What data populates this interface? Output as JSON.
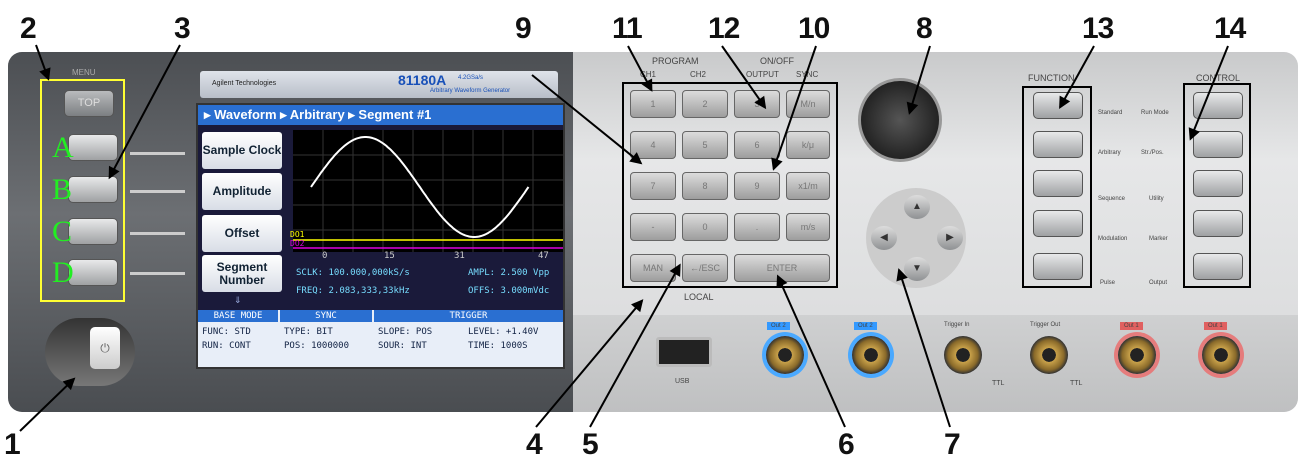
{
  "callouts": [
    "1",
    "2",
    "3",
    "4",
    "5",
    "6",
    "7",
    "8",
    "9",
    "10",
    "11",
    "12",
    "13",
    "14"
  ],
  "menu": {
    "title": "MENU",
    "top_label": "TOP",
    "softkey_letters": [
      "A",
      "B",
      "C",
      "D"
    ]
  },
  "brand": {
    "vendor": "Agilent Technologies",
    "model": "81180A",
    "model_sub": "4.2GSa/s",
    "model_desc": "Arbitrary Waveform Generator"
  },
  "screen": {
    "breadcrumb": "▸ Waveform ▸ Arbitrary ▸ Segment #1",
    "softkeys": [
      "Sample Clock",
      "Amplitude",
      "Offset",
      "Segment Number"
    ],
    "x_ticks": [
      "0",
      "15",
      "31",
      "47"
    ],
    "markers": [
      "DO1",
      "DO2"
    ],
    "readouts": {
      "sclk": "SCLK: 100.000,000kS/s",
      "freq": "FREQ: 2.083,333,33kHz",
      "ampl": "AMPL: 2.500 Vpp",
      "offs": "OFFS: 3.000mVdc"
    },
    "status_headers": [
      "BASE MODE",
      "SYNC",
      "TRIGGER"
    ],
    "status_rows": [
      [
        "FUNC: STD",
        "TYPE: BIT",
        "SLOPE: POS",
        "LEVEL: +1.40V"
      ],
      [
        "RUN: CONT",
        "POS: 1000000",
        "SOUR: INT",
        "TIME: 1000S"
      ]
    ]
  },
  "keypad": {
    "program_label": "PROGRAM",
    "onoff_label": "ON/OFF",
    "ch_labels": [
      "CH1",
      "CH2",
      "OUTPUT",
      "SYNC"
    ],
    "keys": [
      "1",
      "2",
      "3",
      "4",
      "5",
      "6",
      "7",
      "8",
      "9",
      "-",
      "0",
      "."
    ],
    "units": [
      "M/n",
      "k/μ",
      "x1/m",
      "m/s"
    ],
    "bottom": [
      "MAN",
      "←/ESC",
      "ENTER"
    ],
    "local": "LOCAL"
  },
  "function": {
    "title": "FUNCTION",
    "labels": [
      "Standard",
      "Arbitrary",
      "Sequence",
      "Modulation",
      "Pulse"
    ]
  },
  "control": {
    "title": "CONTROL",
    "labels": [
      "Run Mode",
      "Str./Pos.",
      "Utility",
      "Marker",
      "Output"
    ]
  },
  "connectors": {
    "usb": "USB",
    "labels": [
      "Out 2",
      "Out 2",
      "Trigger In",
      "Trigger Out",
      "Out 1",
      "Out 1"
    ],
    "ttl": "TTL"
  }
}
